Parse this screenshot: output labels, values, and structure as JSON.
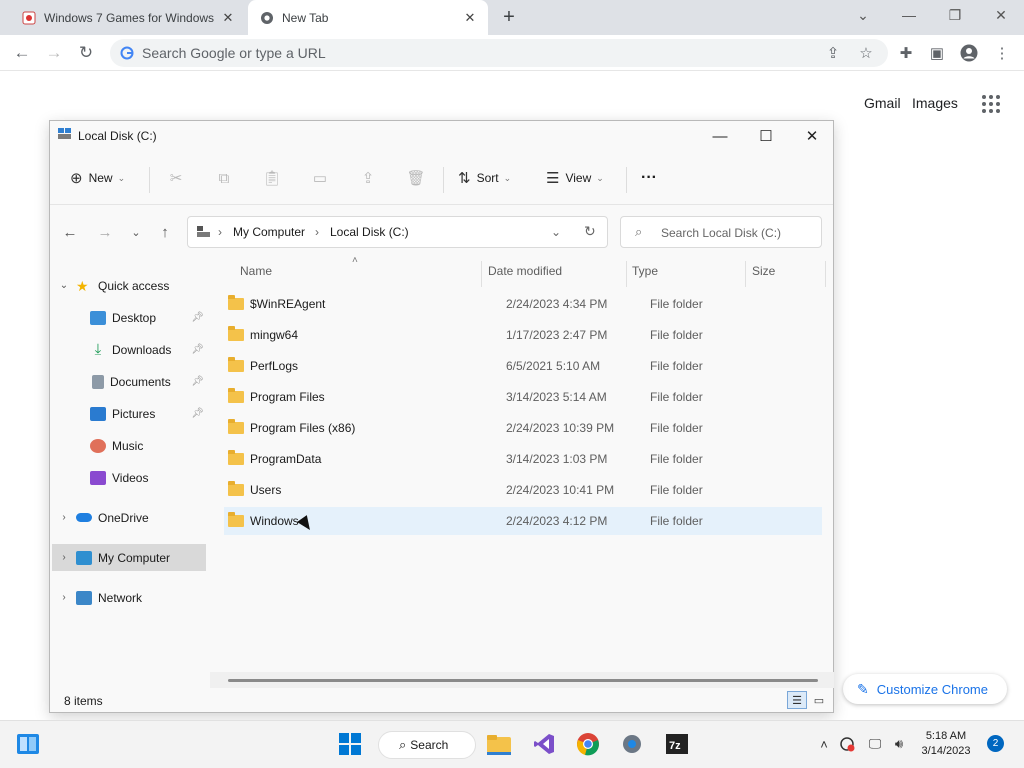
{
  "chrome": {
    "tabs": [
      {
        "title": "Windows 7 Games for Windows",
        "active": false
      },
      {
        "title": "New Tab",
        "active": true
      }
    ],
    "omnibox_placeholder": "Search Google or type a URL",
    "links": {
      "gmail": "Gmail",
      "images": "Images"
    },
    "customize_label": "Customize Chrome"
  },
  "explorer": {
    "title": "Local Disk (C:)",
    "command_bar": {
      "new": "New",
      "sort": "Sort",
      "view": "View",
      "more": "···"
    },
    "breadcrumb": [
      "My Computer",
      "Local Disk (C:)"
    ],
    "search_placeholder": "Search Local Disk (C:)",
    "sidebar": [
      {
        "label": "Quick access",
        "pinned": false
      },
      {
        "label": "Desktop",
        "pinned": true
      },
      {
        "label": "Downloads",
        "pinned": true
      },
      {
        "label": "Documents",
        "pinned": true
      },
      {
        "label": "Pictures",
        "pinned": true
      },
      {
        "label": "Music",
        "pinned": false
      },
      {
        "label": "Videos",
        "pinned": false
      },
      {
        "label": "OneDrive",
        "pinned": false
      },
      {
        "label": "My Computer",
        "pinned": false
      },
      {
        "label": "Network",
        "pinned": false
      }
    ],
    "columns": [
      "Name",
      "Date modified",
      "Type",
      "Size"
    ],
    "files": [
      {
        "name": "$WinREAgent",
        "date": "2/24/2023 4:34 PM",
        "type": "File folder"
      },
      {
        "name": "mingw64",
        "date": "1/17/2023 2:47 PM",
        "type": "File folder"
      },
      {
        "name": "PerfLogs",
        "date": "6/5/2021 5:10 AM",
        "type": "File folder"
      },
      {
        "name": "Program Files",
        "date": "3/14/2023 5:14 AM",
        "type": "File folder"
      },
      {
        "name": "Program Files (x86)",
        "date": "2/24/2023 10:39 PM",
        "type": "File folder"
      },
      {
        "name": "ProgramData",
        "date": "3/14/2023 1:03 PM",
        "type": "File folder"
      },
      {
        "name": "Users",
        "date": "2/24/2023 10:41 PM",
        "type": "File folder"
      },
      {
        "name": "Windows",
        "date": "2/24/2023 4:12 PM",
        "type": "File folder"
      }
    ],
    "status": "8 items"
  },
  "taskbar": {
    "search_label": "Search",
    "time": "5:18 AM",
    "date": "3/14/2023",
    "notification_count": "2"
  },
  "colors": {
    "accent": "#0067c0",
    "chrome_link": "#1a73e8",
    "folder": "#f4c24a",
    "selected_row": "#e5f1fb"
  }
}
